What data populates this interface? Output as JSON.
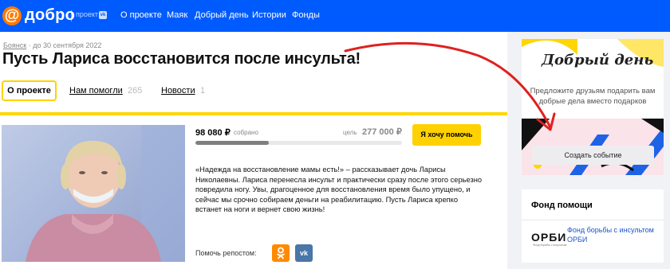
{
  "header": {
    "logo_symbol": "@",
    "logo_text": "добро",
    "project_label": "проект",
    "vk_badge": "vk",
    "nav": [
      "О проекте",
      "Маяк",
      "Добрый день",
      "Истории",
      "Фонды"
    ]
  },
  "breadcrumb": {
    "city": "Боянск",
    "date": " · до 30 сентября 2022"
  },
  "page_title": "Пусть Лариса восстановится после инсульта!",
  "tabs": [
    {
      "label": "О проекте",
      "active": true
    },
    {
      "label": "Нам помогли",
      "count": "265"
    },
    {
      "label": "Новости",
      "count": "1"
    }
  ],
  "fundraising": {
    "raised": "98 080 ₽",
    "raised_label": "собрано",
    "goal_label": "цель",
    "goal": "277 000 ₽",
    "progress_fraction": 0.354,
    "cta": "Я хочу помочь"
  },
  "description": "«Надежда на восстановление мамы есть!» – рассказывает дочь Ларисы Николаевны. Лариса перенесла инсульт и практически сразу после этого серьезно повредила ногу. Увы, драгоценное для восстановления время было упущено, и сейчас мы срочно собираем деньги на реабилитацию. Пусть Лариса крепко встанет на ноги и вернет свою жизнь!",
  "share": {
    "label": "Помочь репостом:",
    "vk_label": "vk"
  },
  "promo": {
    "title": "Добрый день",
    "text": "Предложите друзьям подарить вам добрые дела вместо подарков",
    "button": "Создать событие"
  },
  "fund": {
    "title": "Фонд помощи",
    "logo": "ОРБИ",
    "logo_sub": "Фонд борьбы с инсультом",
    "name": "Фонд борьбы с инсультом ОРБИ"
  },
  "colors": {
    "brand_blue": "#005bff",
    "accent_yellow": "#ffd100",
    "logo_orange": "#ff7a00",
    "annotation_red": "#e02020"
  }
}
